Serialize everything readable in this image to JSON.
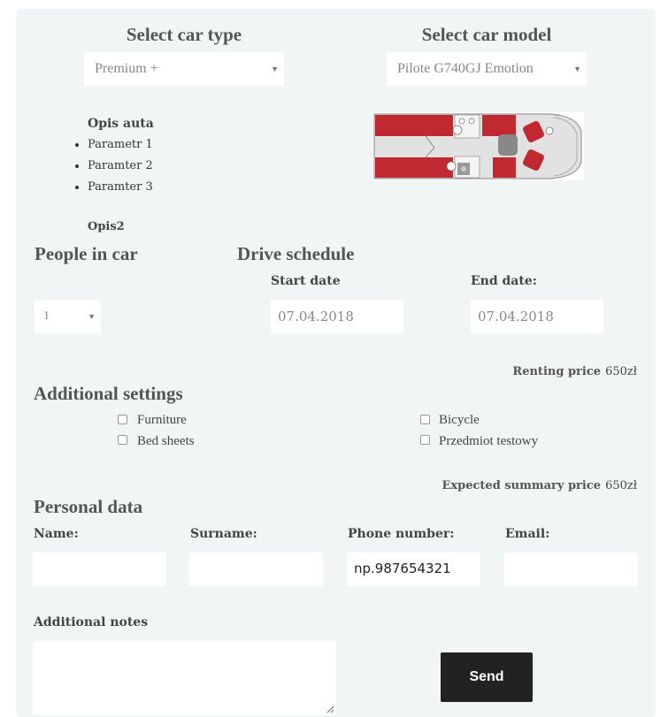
{
  "car_type": {
    "heading": "Select car type",
    "selected": "Premium +"
  },
  "car_model": {
    "heading": "Select car model",
    "selected": "Pilote G740GJ Emotion"
  },
  "description": {
    "title": "Opis auta",
    "params": [
      "Parametr 1",
      "Paramter 2",
      "Paramter 3"
    ],
    "title2": "Opis2"
  },
  "people": {
    "heading": "People in car",
    "selected": "1"
  },
  "schedule": {
    "heading": "Drive schedule",
    "start_label": "Start date",
    "start_value": "07.04.2018",
    "end_label": "End date:",
    "end_value": "07.04.2018"
  },
  "renting": {
    "label": "Renting price",
    "value": "650zł"
  },
  "additional": {
    "heading": "Additional settings",
    "options": [
      "Furniture",
      "Bed sheets",
      "Bicycle",
      "Przedmiot testowy"
    ]
  },
  "summary": {
    "label": "Expected summary price",
    "value": "650zł"
  },
  "personal": {
    "heading": "Personal data",
    "name_label": "Name:",
    "surname_label": "Surname:",
    "phone_label": "Phone number:",
    "phone_placeholder": "np.987654321",
    "email_label": "Email:"
  },
  "notes": {
    "label": "Additional notes"
  },
  "send_label": "Send",
  "colors": {
    "panel": "#f1f5f5",
    "button": "#222222",
    "seat_red": "#c0292f"
  }
}
